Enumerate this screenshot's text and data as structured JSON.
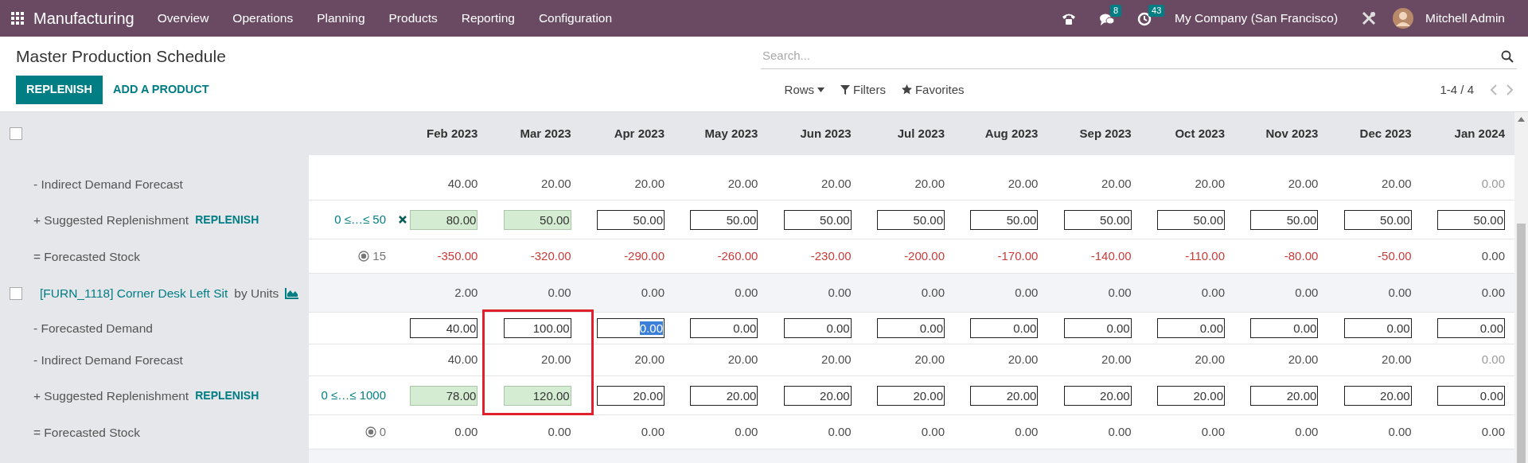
{
  "navbar": {
    "app": "Manufacturing",
    "menu": [
      "Overview",
      "Operations",
      "Planning",
      "Products",
      "Reporting",
      "Configuration"
    ],
    "messages_count": "8",
    "activities_count": "43",
    "company": "My Company (San Francisco)",
    "user": "Mitchell Admin"
  },
  "control_panel": {
    "title": "Master Production Schedule",
    "search": {
      "placeholder": "Search..."
    },
    "buttons": [
      "REPLENISH",
      "ADD A PRODUCT"
    ],
    "rows_menu": "Rows",
    "filters": "Filters",
    "favorites": "Favorites",
    "pager": "1-4 / 4"
  },
  "table": {
    "select_all": {
      "checked": false
    },
    "columns": [
      "Feb 2023",
      "Mar 2023",
      "Apr 2023",
      "May 2023",
      "Jun 2023",
      "Jul 2023",
      "Aug 2023",
      "Sep 2023",
      "Oct 2023",
      "Nov 2023",
      "Dec 2023",
      "Jan 2024"
    ],
    "sections": [
      {
        "rows": [
          {
            "kind": "plain",
            "label": "- Indirect Demand Forecast",
            "cells": [
              {
                "kind": "text",
                "value": "40.00"
              },
              {
                "kind": "text",
                "value": "20.00"
              },
              {
                "kind": "text",
                "value": "20.00"
              },
              {
                "kind": "text",
                "value": "20.00"
              },
              {
                "kind": "text",
                "value": "20.00"
              },
              {
                "kind": "text",
                "value": "20.00"
              },
              {
                "kind": "text",
                "value": "20.00"
              },
              {
                "kind": "text",
                "value": "20.00"
              },
              {
                "kind": "text",
                "value": "20.00"
              },
              {
                "kind": "text",
                "value": "20.00"
              },
              {
                "kind": "text",
                "value": "20.00"
              },
              {
                "kind": "text",
                "value": "0.00",
                "muted": true
              }
            ]
          },
          {
            "kind": "replenish",
            "label": "+ Suggested Replenishment",
            "action": "REPLENISH",
            "range": "0 ≤…≤ 50",
            "cells": [
              {
                "kind": "filled",
                "value": "80.00",
                "reset": true
              },
              {
                "kind": "filled",
                "value": "50.00"
              },
              {
                "kind": "input",
                "value": "50.00"
              },
              {
                "kind": "input",
                "value": "50.00"
              },
              {
                "kind": "input",
                "value": "50.00"
              },
              {
                "kind": "input",
                "value": "50.00"
              },
              {
                "kind": "input",
                "value": "50.00"
              },
              {
                "kind": "input",
                "value": "50.00"
              },
              {
                "kind": "input",
                "value": "50.00"
              },
              {
                "kind": "input",
                "value": "50.00"
              },
              {
                "kind": "input",
                "value": "50.00"
              },
              {
                "kind": "input",
                "value": "50.00"
              }
            ]
          },
          {
            "kind": "stock",
            "label": "= Forecasted Stock",
            "safety": "15",
            "cells": [
              {
                "kind": "text",
                "value": "-350.00",
                "negative": true
              },
              {
                "kind": "text",
                "value": "-320.00",
                "negative": true
              },
              {
                "kind": "text",
                "value": "-290.00",
                "negative": true
              },
              {
                "kind": "text",
                "value": "-260.00",
                "negative": true
              },
              {
                "kind": "text",
                "value": "-230.00",
                "negative": true
              },
              {
                "kind": "text",
                "value": "-200.00",
                "negative": true
              },
              {
                "kind": "text",
                "value": "-170.00",
                "negative": true
              },
              {
                "kind": "text",
                "value": "-140.00",
                "negative": true
              },
              {
                "kind": "text",
                "value": "-110.00",
                "negative": true
              },
              {
                "kind": "text",
                "value": "-80.00",
                "negative": true
              },
              {
                "kind": "text",
                "value": "-50.00",
                "negative": true
              },
              {
                "kind": "text",
                "value": "0.00"
              }
            ]
          }
        ]
      },
      {
        "header": {
          "checked": false,
          "product": "[FURN_1118] Corner Desk Left Sit",
          "unit": "by Units",
          "cells": [
            {
              "kind": "text",
              "value": "2.00"
            },
            {
              "kind": "text",
              "value": "0.00"
            },
            {
              "kind": "text",
              "value": "0.00"
            },
            {
              "kind": "text",
              "value": "0.00"
            },
            {
              "kind": "text",
              "value": "0.00"
            },
            {
              "kind": "text",
              "value": "0.00"
            },
            {
              "kind": "text",
              "value": "0.00"
            },
            {
              "kind": "text",
              "value": "0.00"
            },
            {
              "kind": "text",
              "value": "0.00"
            },
            {
              "kind": "text",
              "value": "0.00"
            },
            {
              "kind": "text",
              "value": "0.00"
            },
            {
              "kind": "text",
              "value": "0.00"
            }
          ]
        },
        "rows": [
          {
            "kind": "plain",
            "label": "- Forecasted Demand",
            "cells": [
              {
                "kind": "input",
                "value": "40.00"
              },
              {
                "kind": "input",
                "value": "100.00",
                "framed": true
              },
              {
                "kind": "input",
                "value": "0.00",
                "text_selected": true
              },
              {
                "kind": "input",
                "value": "0.00"
              },
              {
                "kind": "input",
                "value": "0.00"
              },
              {
                "kind": "input",
                "value": "0.00"
              },
              {
                "kind": "input",
                "value": "0.00"
              },
              {
                "kind": "input",
                "value": "0.00"
              },
              {
                "kind": "input",
                "value": "0.00"
              },
              {
                "kind": "input",
                "value": "0.00"
              },
              {
                "kind": "input",
                "value": "0.00"
              },
              {
                "kind": "input",
                "value": "0.00"
              }
            ]
          },
          {
            "kind": "plain",
            "label": "- Indirect Demand Forecast",
            "cells": [
              {
                "kind": "text",
                "value": "40.00"
              },
              {
                "kind": "text",
                "value": "20.00",
                "framed": true
              },
              {
                "kind": "text",
                "value": "20.00"
              },
              {
                "kind": "text",
                "value": "20.00"
              },
              {
                "kind": "text",
                "value": "20.00"
              },
              {
                "kind": "text",
                "value": "20.00"
              },
              {
                "kind": "text",
                "value": "20.00"
              },
              {
                "kind": "text",
                "value": "20.00"
              },
              {
                "kind": "text",
                "value": "20.00"
              },
              {
                "kind": "text",
                "value": "20.00"
              },
              {
                "kind": "text",
                "value": "20.00"
              },
              {
                "kind": "text",
                "value": "0.00",
                "muted": true
              }
            ]
          },
          {
            "kind": "replenish",
            "label": "+ Suggested Replenishment",
            "action": "REPLENISH",
            "range": "0 ≤…≤ 1000",
            "cells": [
              {
                "kind": "filled",
                "value": "78.00"
              },
              {
                "kind": "filled",
                "value": "120.00",
                "framed": true
              },
              {
                "kind": "input",
                "value": "20.00"
              },
              {
                "kind": "input",
                "value": "20.00"
              },
              {
                "kind": "input",
                "value": "20.00"
              },
              {
                "kind": "input",
                "value": "20.00"
              },
              {
                "kind": "input",
                "value": "20.00"
              },
              {
                "kind": "input",
                "value": "20.00"
              },
              {
                "kind": "input",
                "value": "20.00"
              },
              {
                "kind": "input",
                "value": "20.00"
              },
              {
                "kind": "input",
                "value": "20.00"
              },
              {
                "kind": "input",
                "value": "0.00"
              }
            ]
          },
          {
            "kind": "stock",
            "label": "= Forecasted Stock",
            "safety": "0",
            "cells": [
              {
                "kind": "text",
                "value": "0.00"
              },
              {
                "kind": "text",
                "value": "0.00"
              },
              {
                "kind": "text",
                "value": "0.00"
              },
              {
                "kind": "text",
                "value": "0.00"
              },
              {
                "kind": "text",
                "value": "0.00"
              },
              {
                "kind": "text",
                "value": "0.00"
              },
              {
                "kind": "text",
                "value": "0.00"
              },
              {
                "kind": "text",
                "value": "0.00"
              },
              {
                "kind": "text",
                "value": "0.00"
              },
              {
                "kind": "text",
                "value": "0.00"
              },
              {
                "kind": "text",
                "value": "0.00"
              },
              {
                "kind": "text",
                "value": "0.00"
              }
            ]
          }
        ]
      }
    ]
  }
}
